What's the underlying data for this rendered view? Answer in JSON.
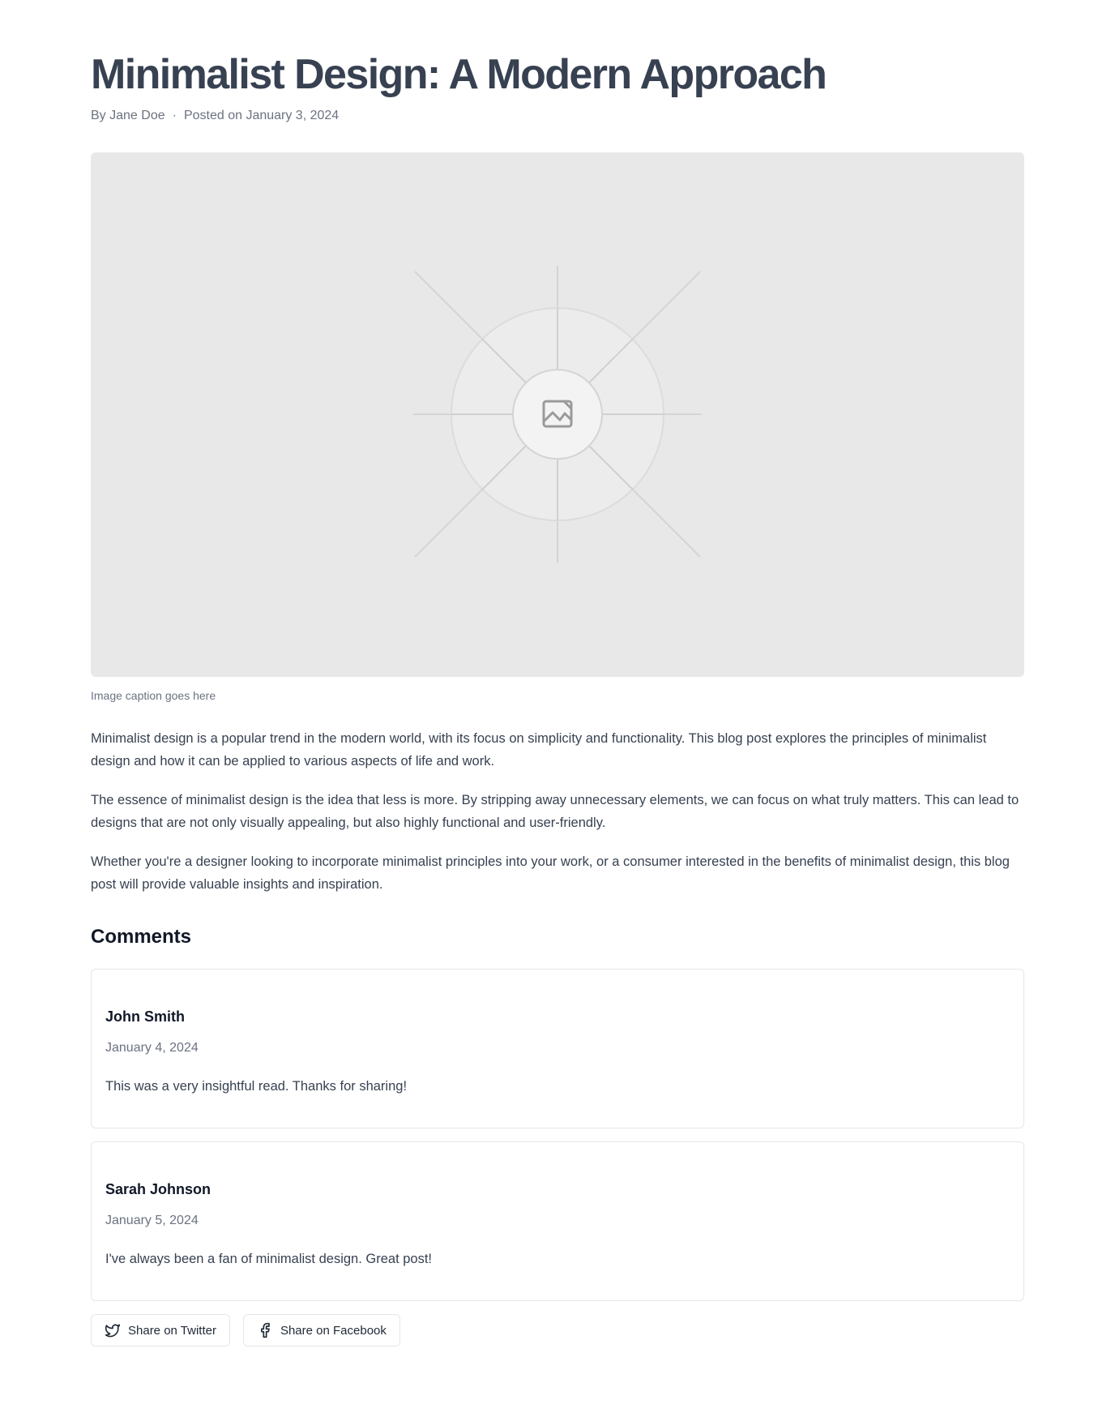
{
  "post": {
    "title": "Minimalist Design: A Modern Approach",
    "author": "By Jane Doe",
    "separator": "·",
    "posted": "Posted on January 3, 2024"
  },
  "hero": {
    "icon": "image-icon",
    "caption": "Image caption goes here"
  },
  "paragraphs": [
    "Minimalist design is a popular trend in the modern world, with its focus on simplicity and functionality. This blog post explores the principles of minimalist design and how it can be applied to various aspects of life and work.",
    "The essence of minimalist design is the idea that less is more. By stripping away unnecessary elements, we can focus on what truly matters. This can lead to designs that are not only visually appealing, but also highly functional and user-friendly.",
    "Whether you're a designer looking to incorporate minimalist principles into your work, or a consumer interested in the benefits of minimalist design, this blog post will provide valuable insights and inspiration."
  ],
  "comments": {
    "heading": "Comments",
    "items": [
      {
        "author": "John Smith",
        "date": "January 4, 2024",
        "text": "This was a very insightful read. Thanks for sharing!"
      },
      {
        "author": "Sarah Johnson",
        "date": "January 5, 2024",
        "text": "I've always been a fan of minimalist design. Great post!"
      }
    ]
  },
  "share": {
    "twitter_label": "Share on Twitter",
    "twitter_icon": "twitter-icon",
    "facebook_label": "Share on Facebook",
    "facebook_icon": "facebook-icon"
  },
  "colors": {
    "title": "#374151",
    "muted": "#6b7280",
    "heading": "#111827",
    "hero_background": "#e8e8e8",
    "border": "#e5e7eb"
  }
}
